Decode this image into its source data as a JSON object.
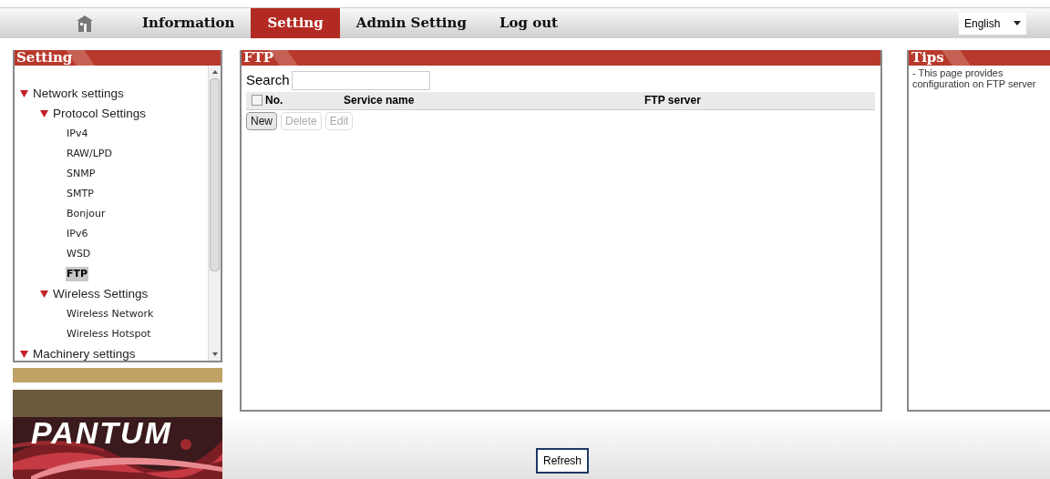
{
  "nav": {
    "tabs": [
      {
        "label": "Information",
        "selected": false
      },
      {
        "label": "Setting",
        "selected": true
      },
      {
        "label": "Admin Setting",
        "selected": false
      },
      {
        "label": "Log out",
        "selected": false
      }
    ],
    "language": "English"
  },
  "sidebar": {
    "title": "Setting",
    "tree": [
      {
        "label": "Network settings",
        "expanded": true,
        "children": [
          {
            "label": "Protocol Settings",
            "expanded": true,
            "children": [
              {
                "label": "IPv4",
                "selected": false
              },
              {
                "label": "RAW/LPD",
                "selected": false
              },
              {
                "label": "SNMP",
                "selected": false
              },
              {
                "label": "SMTP",
                "selected": false
              },
              {
                "label": "Bonjour",
                "selected": false
              },
              {
                "label": "IPv6",
                "selected": false
              },
              {
                "label": "WSD",
                "selected": false
              },
              {
                "label": "FTP",
                "selected": true
              }
            ]
          },
          {
            "label": "Wireless Settings",
            "expanded": true,
            "children": [
              {
                "label": "Wireless Network",
                "selected": false
              },
              {
                "label": "Wireless Hotspot",
                "selected": false
              }
            ]
          }
        ]
      },
      {
        "label": "Machinery settings",
        "expanded": true
      }
    ]
  },
  "logo": {
    "text": "PANTUM"
  },
  "main": {
    "title": "FTP",
    "search_label": "Search",
    "table": {
      "select_all_checked": false,
      "columns": [
        "No.",
        "Service name",
        "FTP server"
      ]
    },
    "buttons": [
      {
        "label": "New",
        "disabled": false
      },
      {
        "label": "Delete",
        "disabled": true
      },
      {
        "label": "Edit",
        "disabled": true
      }
    ]
  },
  "tips": {
    "title": "Tips",
    "text": "- This page provides configuration on FTP server"
  },
  "footer": {
    "button": "Refresh"
  }
}
